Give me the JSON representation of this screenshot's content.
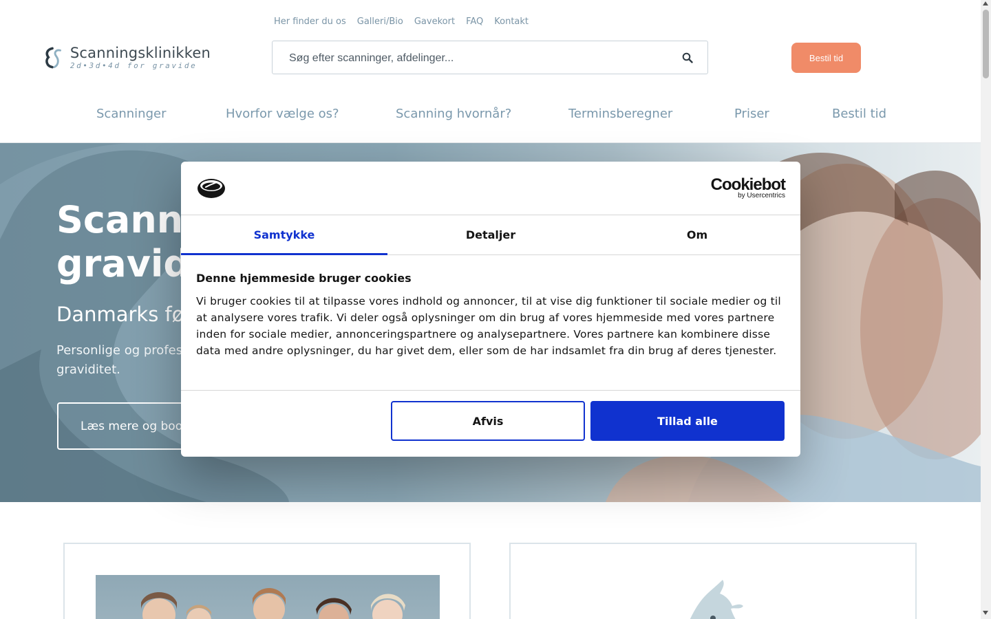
{
  "header": {
    "utility_links": [
      "Her finder du os",
      "Galleri/Bio",
      "Gavekort",
      "FAQ",
      "Kontakt"
    ],
    "logo": {
      "name": "Scanningsklinikken",
      "tagline": "2d•3d•4d for gravide"
    },
    "search": {
      "placeholder": "Søg efter scanninger, afdelinger..."
    },
    "book_button": "Bestil tid",
    "main_nav": [
      "Scanninger",
      "Hvorfor vælge os?",
      "Scanning hvornår?",
      "Terminsberegner",
      "Priser",
      "Bestil tid"
    ]
  },
  "hero": {
    "title_line1": "Scanning for",
    "title_line2": "gravide",
    "subtitle": "Danmarks førende",
    "text_line1": "Personlige og professionelle scanninger",
    "text_line2": "graviditet.",
    "button": "Læs mere og book"
  },
  "cookie_dialog": {
    "brand": {
      "name": "Cookiebot",
      "by": "by Usercentrics"
    },
    "tabs": [
      "Samtykke",
      "Detaljer",
      "Om"
    ],
    "active_tab": "Samtykke",
    "heading": "Denne hjemmeside bruger cookies",
    "body": "Vi bruger cookies til at tilpasse vores indhold og annoncer, til at vise dig funktioner til sociale medier og til at analysere vores trafik. Vi deler også oplysninger om din brug af vores hjemmeside med vores partnere inden for sociale medier, annonceringspartnere og analysepartnere. Vores partnere kan kombinere disse data med andre oplysninger, du har givet dem, eller som de har indsamlet fra din brug af deres tjenester.",
    "deny_button": "Afvis",
    "allow_button": "Tillad alle"
  },
  "colors": {
    "accent_orange": "#f08b68",
    "nav_blue_grey": "#7a98ac",
    "cookiebot_blue": "#1032cf"
  }
}
